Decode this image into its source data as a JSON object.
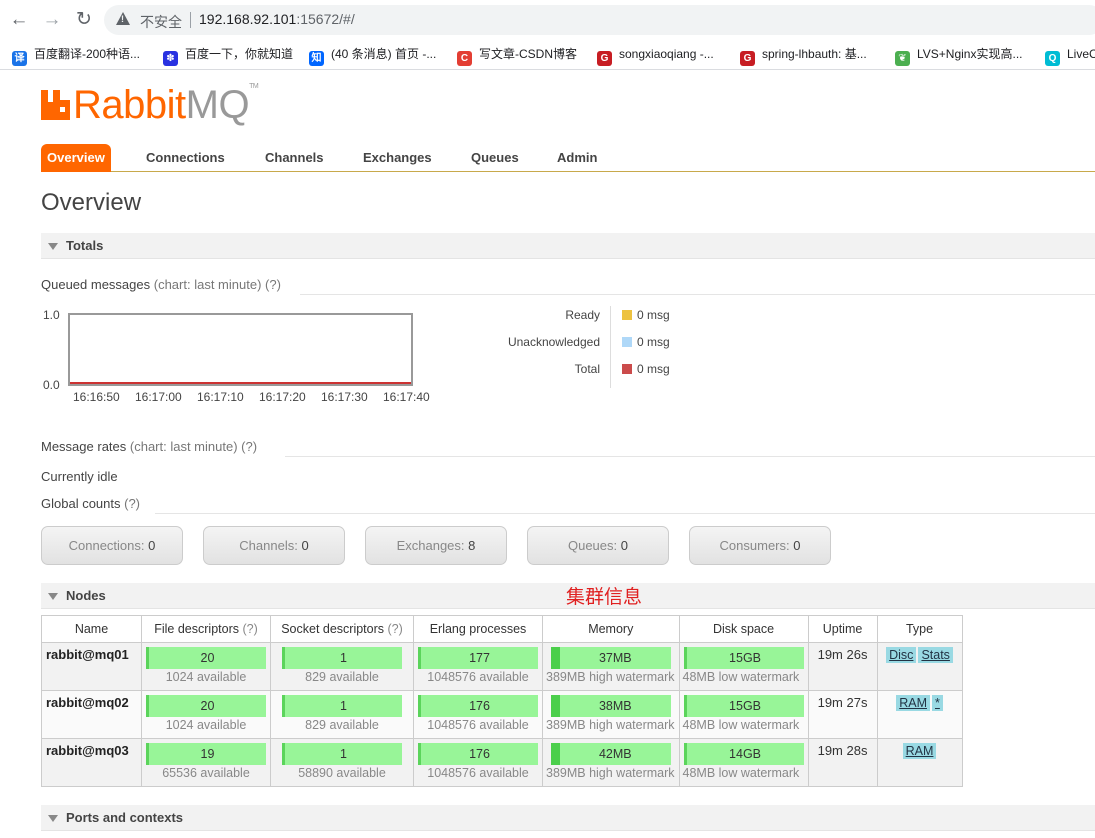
{
  "browser": {
    "insecure_label": "不安全",
    "url_host": "192.168.92.101",
    "url_rest": ":15672/#/",
    "bookmarks": [
      {
        "label": "百度翻译-200种语...",
        "icon": "translate-icon",
        "color": "#1a73e8"
      },
      {
        "label": "百度一下，你就知道",
        "icon": "baidu-paw-icon",
        "color": "#2932e1"
      },
      {
        "label": "(40 条消息) 首页 -...",
        "icon": "zhihu-icon",
        "color": "#0066ff"
      },
      {
        "label": "写文章-CSDN博客",
        "icon": "csdn-icon",
        "color": "#e33e33"
      },
      {
        "label": "songxiaoqiang -...",
        "icon": "gitee-icon",
        "color": "#c71d23"
      },
      {
        "label": "spring-lhbauth: 基...",
        "icon": "gitee-g-icon",
        "color": "#c71d23"
      },
      {
        "label": "LVS+Nginx实现高...",
        "icon": "leaf-icon",
        "color": "#4caf50"
      },
      {
        "label": "LiveC",
        "icon": "livec-icon",
        "color": "#00bcd4"
      }
    ]
  },
  "app": {
    "logo_rabbit": "Rabbit",
    "logo_mq": "MQ",
    "logo_tm": "TM",
    "brand_color": "#ff6600",
    "tabs": [
      "Overview",
      "Connections",
      "Channels",
      "Exchanges",
      "Queues",
      "Admin"
    ],
    "page_title": "Overview"
  },
  "totals": {
    "heading": "Totals",
    "queued_label": "Queued messages",
    "queued_hint": "(chart: last minute)",
    "help": "(?)",
    "chart_data": {
      "type": "line",
      "x": [
        "16:16:50",
        "16:17:00",
        "16:17:10",
        "16:17:20",
        "16:17:30",
        "16:17:40"
      ],
      "ylim": [
        0.0,
        1.0
      ],
      "y_ticks": [
        "1.0",
        "0.0"
      ],
      "series": [
        {
          "name": "Ready",
          "values": [
            0,
            0,
            0,
            0,
            0,
            0
          ],
          "color": "#edc240"
        },
        {
          "name": "Unacknowledged",
          "values": [
            0,
            0,
            0,
            0,
            0,
            0
          ],
          "color": "#afd8f8"
        },
        {
          "name": "Total",
          "values": [
            0,
            0,
            0,
            0,
            0,
            0
          ],
          "color": "#cb4b4b"
        }
      ]
    },
    "legend": [
      {
        "name": "Ready",
        "value": "0 msg",
        "color": "#edc240"
      },
      {
        "name": "Unacknowledged",
        "value": "0 msg",
        "color": "#afd8f8"
      },
      {
        "name": "Total",
        "value": "0 msg",
        "color": "#cb4b4b"
      }
    ],
    "rates_label": "Message rates",
    "rates_hint": "(chart: last minute)",
    "idle": "Currently idle",
    "global_label": "Global counts",
    "counts": [
      {
        "label": "Connections:",
        "value": "0"
      },
      {
        "label": "Channels:",
        "value": "0"
      },
      {
        "label": "Exchanges:",
        "value": "8"
      },
      {
        "label": "Queues:",
        "value": "0"
      },
      {
        "label": "Consumers:",
        "value": "0"
      }
    ]
  },
  "annotation": "集群信息",
  "nodes": {
    "heading": "Nodes",
    "columns": [
      "Name",
      "File descriptors",
      "Socket descriptors",
      "Erlang processes",
      "Memory",
      "Disk space",
      "Uptime",
      "Type"
    ],
    "rows": [
      {
        "name": "rabbit@mq01",
        "fd": "20",
        "fd_avail": "1024 available",
        "sd": "1",
        "sd_avail": "829 available",
        "ep": "177",
        "ep_avail": "1048576 available",
        "mem": "37MB",
        "mem_wm": "389MB high watermark",
        "disk": "15GB",
        "disk_wm": "48MB low watermark",
        "uptime": "19m 26s",
        "types": [
          "Disc",
          "Stats"
        ]
      },
      {
        "name": "rabbit@mq02",
        "fd": "20",
        "fd_avail": "1024 available",
        "sd": "1",
        "sd_avail": "829 available",
        "ep": "176",
        "ep_avail": "1048576 available",
        "mem": "38MB",
        "mem_wm": "389MB high watermark",
        "disk": "15GB",
        "disk_wm": "48MB low watermark",
        "uptime": "19m 27s",
        "types": [
          "RAM",
          "*"
        ]
      },
      {
        "name": "rabbit@mq03",
        "fd": "19",
        "fd_avail": "65536 available",
        "sd": "1",
        "sd_avail": "58890 available",
        "ep": "176",
        "ep_avail": "1048576 available",
        "mem": "42MB",
        "mem_wm": "389MB high watermark",
        "disk": "14GB",
        "disk_wm": "48MB low watermark",
        "uptime": "19m 28s",
        "types": [
          "RAM"
        ]
      }
    ]
  },
  "ports": {
    "heading": "Ports and contexts"
  }
}
